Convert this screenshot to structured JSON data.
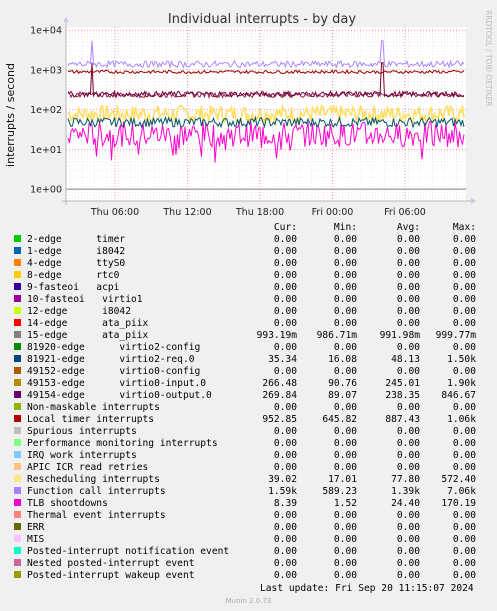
{
  "side_label": "RRDTOOL / TOBI OETIKER",
  "chart_data": {
    "type": "line",
    "title": "Individual interrupts - by day",
    "ylabel": "interrupts / second",
    "yscale": "log",
    "ylim": [
      0.5,
      12000
    ],
    "y_ticks": [
      {
        "label": "1e+00",
        "value": 1
      },
      {
        "label": "1e+01",
        "value": 10
      },
      {
        "label": "1e+02",
        "value": 100
      },
      {
        "label": "1e+03",
        "value": 1000
      },
      {
        "label": "1e+04",
        "value": 10000
      }
    ],
    "x_ticks": [
      "Thu 06:00",
      "Thu 12:00",
      "Thu 18:00",
      "Fri 00:00",
      "Fri 06:00"
    ],
    "grid": true,
    "series": [
      {
        "name": "Function call interrupts",
        "color": "#aa88ff",
        "approx_level": 1390,
        "spikes_to": 7060
      },
      {
        "name": "Local timer interrupts",
        "color": "#990000",
        "approx_level": 890,
        "spikes_to": 1060
      },
      {
        "name": "49153-edge virtio0-input.0",
        "color": "#770033",
        "approx_level": 245,
        "spikes_to": 1900
      },
      {
        "name": "49154-edge virtio0-output.0",
        "color": "#882255",
        "approx_level": 238
      },
      {
        "name": "Rescheduling interrupts",
        "color": "#ffe066",
        "approx_level": 78
      },
      {
        "name": "81921-edge virtio2-req.0",
        "color": "#005566",
        "approx_level": 48
      },
      {
        "name": "TLB shootdowns",
        "color": "#ff00cc",
        "approx_level": 24
      }
    ]
  },
  "legend": {
    "headers": [
      "Cur:",
      "Min:",
      "Avg:",
      "Max:"
    ],
    "rows": [
      {
        "name": "2-edge      timer",
        "color": "#00cc00",
        "cur": "0.00",
        "min": "0.00",
        "avg": "0.00",
        "max": "0.00"
      },
      {
        "name": "1-edge      i8042",
        "color": "#0066b3",
        "cur": "0.00",
        "min": "0.00",
        "avg": "0.00",
        "max": "0.00"
      },
      {
        "name": "4-edge      ttyS0",
        "color": "#ff8000",
        "cur": "0.00",
        "min": "0.00",
        "avg": "0.00",
        "max": "0.00"
      },
      {
        "name": "8-edge      rtc0",
        "color": "#ffcc00",
        "cur": "0.00",
        "min": "0.00",
        "avg": "0.00",
        "max": "0.00"
      },
      {
        "name": "9-fasteoi   acpi",
        "color": "#330099",
        "cur": "0.00",
        "min": "0.00",
        "avg": "0.00",
        "max": "0.00"
      },
      {
        "name": "10-fasteoi   virtio1",
        "color": "#990099",
        "cur": "0.00",
        "min": "0.00",
        "avg": "0.00",
        "max": "0.00"
      },
      {
        "name": "12-edge      i8042",
        "color": "#ccff00",
        "cur": "0.00",
        "min": "0.00",
        "avg": "0.00",
        "max": "0.00"
      },
      {
        "name": "14-edge      ata_piix",
        "color": "#ff0000",
        "cur": "0.00",
        "min": "0.00",
        "avg": "0.00",
        "max": "0.00"
      },
      {
        "name": "15-edge      ata_piix",
        "color": "#808080",
        "cur": "993.19m",
        "min": "986.71m",
        "avg": "991.98m",
        "max": "999.77m"
      },
      {
        "name": "81920-edge      virtio2-config",
        "color": "#008f00",
        "cur": "0.00",
        "min": "0.00",
        "avg": "0.00",
        "max": "0.00"
      },
      {
        "name": "81921-edge      virtio2-req.0",
        "color": "#00487d",
        "cur": "35.34",
        "min": "16.08",
        "avg": "48.13",
        "max": "1.50k"
      },
      {
        "name": "49152-edge      virtio0-config",
        "color": "#b35a00",
        "cur": "0.00",
        "min": "0.00",
        "avg": "0.00",
        "max": "0.00"
      },
      {
        "name": "49153-edge      virtio0-input.0",
        "color": "#b38f00",
        "cur": "266.48",
        "min": "90.76",
        "avg": "245.01",
        "max": "1.90k"
      },
      {
        "name": "49154-edge      virtio0-output.0",
        "color": "#6b006b",
        "cur": "269.84",
        "min": "89.07",
        "avg": "238.35",
        "max": "846.67"
      },
      {
        "name": "Non-maskable interrupts",
        "color": "#8fb300",
        "cur": "0.00",
        "min": "0.00",
        "avg": "0.00",
        "max": "0.00"
      },
      {
        "name": "Local timer interrupts",
        "color": "#b30000",
        "cur": "952.85",
        "min": "645.82",
        "avg": "887.43",
        "max": "1.06k"
      },
      {
        "name": "Spurious interrupts",
        "color": "#bebebe",
        "cur": "0.00",
        "min": "0.00",
        "avg": "0.00",
        "max": "0.00"
      },
      {
        "name": "Performance monitoring interrupts",
        "color": "#80ff80",
        "cur": "0.00",
        "min": "0.00",
        "avg": "0.00",
        "max": "0.00"
      },
      {
        "name": "IRQ work interrupts",
        "color": "#80c9ff",
        "cur": "0.00",
        "min": "0.00",
        "avg": "0.00",
        "max": "0.00"
      },
      {
        "name": "APIC ICR read retries",
        "color": "#ffc080",
        "cur": "0.00",
        "min": "0.00",
        "avg": "0.00",
        "max": "0.00"
      },
      {
        "name": "Rescheduling interrupts",
        "color": "#ffe680",
        "cur": "39.02",
        "min": "17.01",
        "avg": "77.80",
        "max": "572.40"
      },
      {
        "name": "Function call interrupts",
        "color": "#aa80ff",
        "cur": "1.59k",
        "min": "589.23",
        "avg": "1.39k",
        "max": "7.06k"
      },
      {
        "name": "TLB shootdowns",
        "color": "#ee00cc",
        "cur": "8.39",
        "min": "1.52",
        "avg": "24.40",
        "max": "170.19"
      },
      {
        "name": "Thermal event interrupts",
        "color": "#ff8080",
        "cur": "0.00",
        "min": "0.00",
        "avg": "0.00",
        "max": "0.00"
      },
      {
        "name": "ERR",
        "color": "#666600",
        "cur": "0.00",
        "min": "0.00",
        "avg": "0.00",
        "max": "0.00"
      },
      {
        "name": "MIS",
        "color": "#ffbfff",
        "cur": "0.00",
        "min": "0.00",
        "avg": "0.00",
        "max": "0.00"
      },
      {
        "name": "Posted-interrupt notification event",
        "color": "#00ffcc",
        "cur": "0.00",
        "min": "0.00",
        "avg": "0.00",
        "max": "0.00"
      },
      {
        "name": "Nested posted-interrupt event",
        "color": "#cc6699",
        "cur": "0.00",
        "min": "0.00",
        "avg": "0.00",
        "max": "0.00"
      },
      {
        "name": "Posted-interrupt wakeup event",
        "color": "#999900",
        "cur": "0.00",
        "min": "0.00",
        "avg": "0.00",
        "max": "0.00"
      }
    ]
  },
  "last_update": "Last update:  Fri Sep 20 11:15:07 2024",
  "footer": "Munin 2.0.73"
}
